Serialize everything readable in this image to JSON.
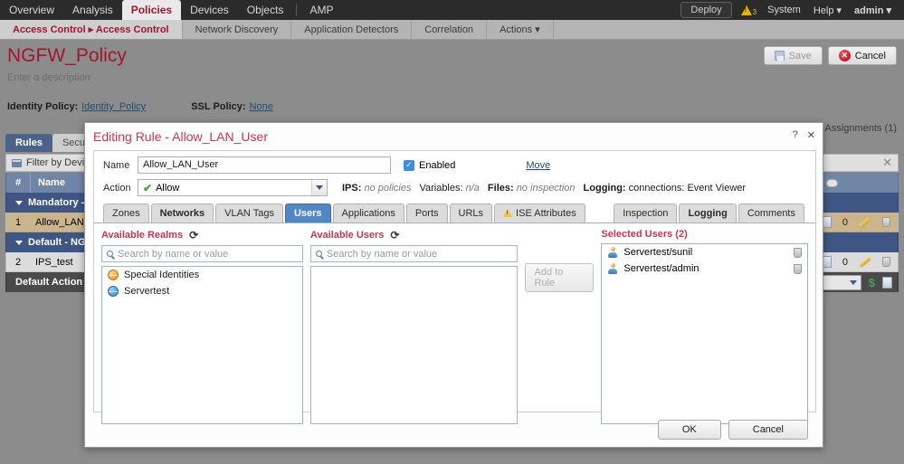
{
  "topnav": {
    "items": [
      {
        "label": "Overview",
        "active": false
      },
      {
        "label": "Analysis",
        "active": false
      },
      {
        "label": "Policies",
        "active": true
      },
      {
        "label": "Devices",
        "active": false
      },
      {
        "label": "Objects",
        "active": false
      },
      {
        "label": "AMP",
        "active": false
      }
    ],
    "deploy_label": "Deploy",
    "warning_count": "3",
    "system_label": "System",
    "help_label": "Help ▾",
    "user_label": "admin ▾"
  },
  "subnav": {
    "items": [
      {
        "label": "Access Control ▸ Access Control",
        "active": true
      },
      {
        "label": "Network Discovery",
        "active": false
      },
      {
        "label": "Application Detectors",
        "active": false
      },
      {
        "label": "Correlation",
        "active": false
      },
      {
        "label": "Actions ▾",
        "active": false
      }
    ]
  },
  "page": {
    "title": "NGFW_Policy",
    "description": "Enter a description",
    "identity_policy_label": "Identity Policy:",
    "identity_policy_value": "Identity_Policy",
    "ssl_policy_label": "SSL Policy:",
    "ssl_policy_value": "None",
    "save_label": "Save",
    "cancel_label": "Cancel",
    "assignments_label": "y Assignments (1)"
  },
  "rules_panel": {
    "tabs": [
      {
        "label": "Rules",
        "active": true
      },
      {
        "label": "Securit",
        "active": false
      }
    ],
    "filter_placeholder": "Filter by Devic",
    "filter_close": "✕",
    "columns": [
      "#",
      "Name"
    ],
    "rows": [
      {
        "type": "section",
        "label": "Mandatory - "
      },
      {
        "type": "rule",
        "num": "1",
        "name": "Allow_LAN_U",
        "count": "0"
      },
      {
        "type": "section",
        "label": "Default - NGF"
      },
      {
        "type": "rule",
        "num": "2",
        "name": "IPS_test",
        "count": "0"
      },
      {
        "type": "default",
        "label": "Default Action"
      }
    ]
  },
  "modal": {
    "title": "Editing Rule - Allow_LAN_User",
    "help_icon": "?",
    "close_icon": "✕",
    "name_label": "Name",
    "name_value": "Allow_LAN_User",
    "enabled_label": "Enabled",
    "enabled_checked": "✓",
    "move_label": "Move",
    "action_label": "Action",
    "action_value": "Allow",
    "meta": {
      "ips_label": "IPS:",
      "ips_value": "no policies",
      "variables_label": "Variables:",
      "variables_value": "n/a",
      "files_label": "Files:",
      "files_value": "no inspection",
      "logging_label": "Logging:",
      "logging_value": "connections: Event Viewer"
    },
    "tabs_left": [
      {
        "label": "Zones",
        "state": "normal"
      },
      {
        "label": "Networks",
        "state": "bold"
      },
      {
        "label": "VLAN Tags",
        "state": "normal"
      },
      {
        "label": "Users",
        "state": "active"
      },
      {
        "label": "Applications",
        "state": "normal"
      },
      {
        "label": "Ports",
        "state": "normal"
      },
      {
        "label": "URLs",
        "state": "normal"
      },
      {
        "label": "ISE Attributes",
        "state": "warn"
      }
    ],
    "tabs_right": [
      {
        "label": "Inspection",
        "state": "normal"
      },
      {
        "label": "Logging",
        "state": "bold"
      },
      {
        "label": "Comments",
        "state": "normal"
      }
    ],
    "realms": {
      "title": "Available Realms",
      "refresh_icon": "⟳",
      "search_placeholder": "Search by name or value",
      "items": [
        {
          "label": "Special Identities",
          "icon": "globe-orange-icon"
        },
        {
          "label": "Servertest",
          "icon": "globe-blue-icon"
        }
      ]
    },
    "users": {
      "title": "Available Users",
      "refresh_icon": "⟳",
      "search_placeholder": "Search by name or value",
      "items": []
    },
    "add_to_rule_label": "Add to Rule",
    "selected": {
      "title": "Selected Users (2)",
      "items": [
        {
          "label": "Servertest/sunil"
        },
        {
          "label": "Servertest/admin"
        }
      ]
    },
    "ok_label": "OK",
    "cancel_label": "Cancel"
  }
}
